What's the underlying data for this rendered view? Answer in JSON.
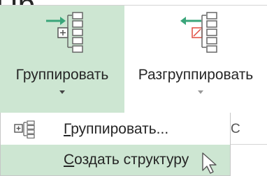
{
  "background_text": "Пр",
  "ribbon": {
    "group_button": {
      "label": "Группировать",
      "active": true
    },
    "ungroup_button": {
      "label": "Разгруппировать",
      "active": false
    }
  },
  "dropdown": {
    "items": [
      {
        "label_rest": "руппировать...",
        "accesskey": "Г",
        "icon": "group-icon"
      },
      {
        "label_rest": "оздать структуру",
        "accesskey": "С",
        "icon": "",
        "hovered": true
      }
    ]
  },
  "side_fragment": "С",
  "colors": {
    "hover_bg": "#cde6d2",
    "arrow_green": "#3aa57a",
    "arrow_red": "#e04a3f",
    "text": "#262626"
  }
}
